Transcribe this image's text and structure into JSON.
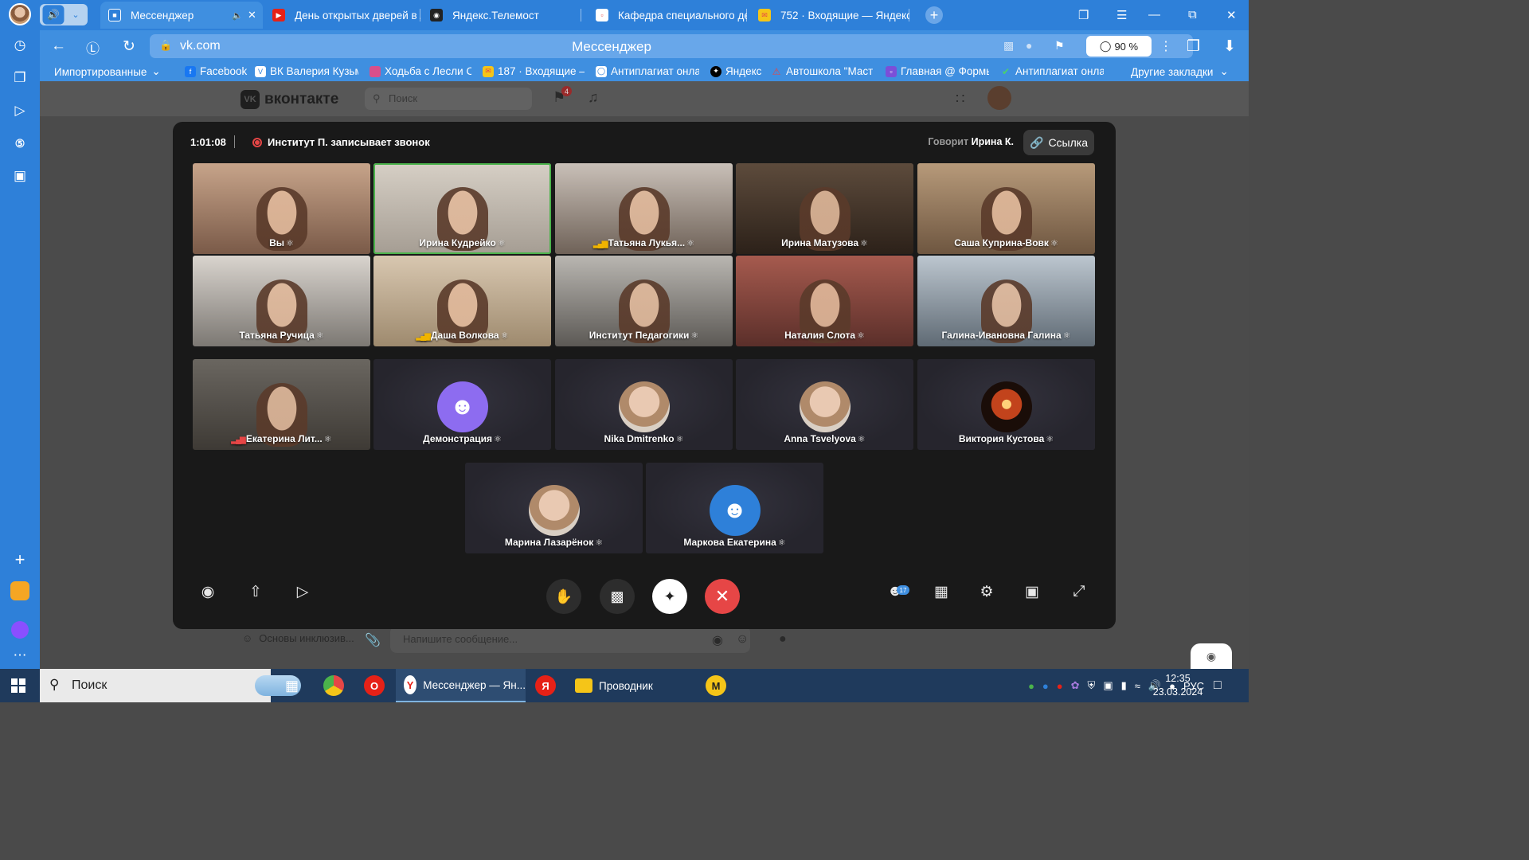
{
  "browser": {
    "tabs": [
      {
        "title": "Мессенджер",
        "favicon": "vk-messenger-icon",
        "active": true
      },
      {
        "title": "День открытых дверей в /",
        "favicon": "youtube-icon"
      },
      {
        "title": "Яндекс.Телемост",
        "favicon": "telemost-icon"
      },
      {
        "title": "Кафедра специального де",
        "favicon": "document-icon"
      },
      {
        "title": "752 · Входящие — Яндекс",
        "favicon": "yandex-mail-icon"
      }
    ],
    "url": "vk.com",
    "page_title": "Мессенджер",
    "zoom": "90 %",
    "bookmarks": [
      "Импортированные",
      "Facebook",
      "ВК Валерия Кузьм",
      "Ходьба с Лесли С",
      "187 · Входящие —",
      "Антиплагиат онла",
      "Яндекс",
      "Автошкола \"Маст",
      "Главная @ Формы",
      "Антиплагиат онла"
    ],
    "other_bookmarks": "Другие закладки"
  },
  "vk": {
    "logo": "вконтакте",
    "search_placeholder": "Поиск",
    "notif_count": "4",
    "chat_name": "Основы инклюзив...",
    "message_placeholder": "Напишите сообщение..."
  },
  "call": {
    "timer": "1:01:08",
    "recording_text": "Институт П. записывает звонок",
    "speaking_prefix": "Говорит",
    "speaking_name": "Ирина К.",
    "link_label": "Ссылка",
    "participants_count": "17",
    "participants": [
      {
        "name": "Вы",
        "kind": "cam"
      },
      {
        "name": "Ирина Кудрейко",
        "kind": "cam",
        "speaking": true
      },
      {
        "name": "Татьяна Лукья...",
        "kind": "cam",
        "signal": "yellow"
      },
      {
        "name": "Ирина Матузова",
        "kind": "cam"
      },
      {
        "name": "Саша Куприна-Вовк",
        "kind": "cam"
      },
      {
        "name": "Татьяна Ручица",
        "kind": "cam"
      },
      {
        "name": "Даша Волкова",
        "kind": "cam",
        "signal": "yellow"
      },
      {
        "name": "Институт Педагогики",
        "kind": "cam"
      },
      {
        "name": "Наталия Слота",
        "kind": "cam"
      },
      {
        "name": "Галина-Ивановна Галина",
        "kind": "cam"
      },
      {
        "name": "Екатерина Лит...",
        "kind": "cam",
        "signal": "red"
      },
      {
        "name": "Демонстрация",
        "kind": "avatar",
        "avatar": "cat-avatar-icon"
      },
      {
        "name": "Nika Dmitrenko",
        "kind": "avatar",
        "avatar": "photo-avatar"
      },
      {
        "name": "Anna Tsvelyova",
        "kind": "avatar",
        "avatar": "photo-avatar"
      },
      {
        "name": "Виктория Кустова",
        "kind": "avatar",
        "avatar": "candle-avatar"
      },
      {
        "name": "Марина Лазарёнок",
        "kind": "avatar",
        "avatar": "photo-avatar"
      },
      {
        "name": "Маркова Екатерина",
        "kind": "avatar",
        "avatar": "unicorn-avatar-icon"
      }
    ]
  },
  "taskbar": {
    "search_placeholder": "Поиск",
    "apps": [
      {
        "label": "Мессенджер — Ян...",
        "icon": "yandex-browser-icon",
        "running": true
      },
      {
        "label": "Проводник",
        "icon": "folder-icon",
        "running": false
      }
    ],
    "language": "РУС",
    "time": "12:35",
    "date": "23.03.2024"
  },
  "colors": {
    "accent": "#2e80d9",
    "hangup": "#e64646",
    "speaking_border": "#4bb34b"
  }
}
